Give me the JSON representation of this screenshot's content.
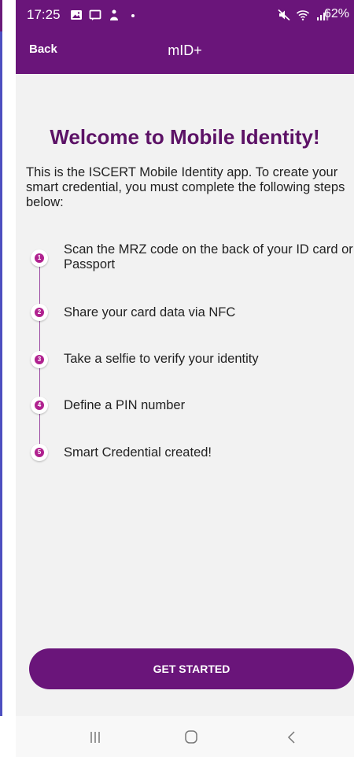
{
  "status_bar": {
    "time": "17:25",
    "battery": "62%"
  },
  "app_bar": {
    "back_label": "Back",
    "title": "mID+"
  },
  "content": {
    "welcome": "Welcome to Mobile Identity!",
    "intro": "This is the ISCERT Mobile Identity app. To create your smart credential, you must complete the following steps below:",
    "steps": [
      {
        "number": "1",
        "label": "Scan the MRZ code on the back of your ID card or Passport"
      },
      {
        "number": "2",
        "label": "Share your card data via NFC"
      },
      {
        "number": "3",
        "label": "Take a selfie to verify your identity"
      },
      {
        "number": "4",
        "label": "Define a PIN number"
      },
      {
        "number": "5",
        "label": "Smart Credential created!"
      }
    ]
  },
  "cta": {
    "label": "GET STARTED"
  },
  "colors": {
    "primary": "#6a157a",
    "accent": "#b0218f",
    "title": "#5c1266",
    "background": "#f2f2f2"
  },
  "nav": {
    "icons": [
      "recent-apps-icon",
      "home-icon",
      "back-icon"
    ]
  }
}
